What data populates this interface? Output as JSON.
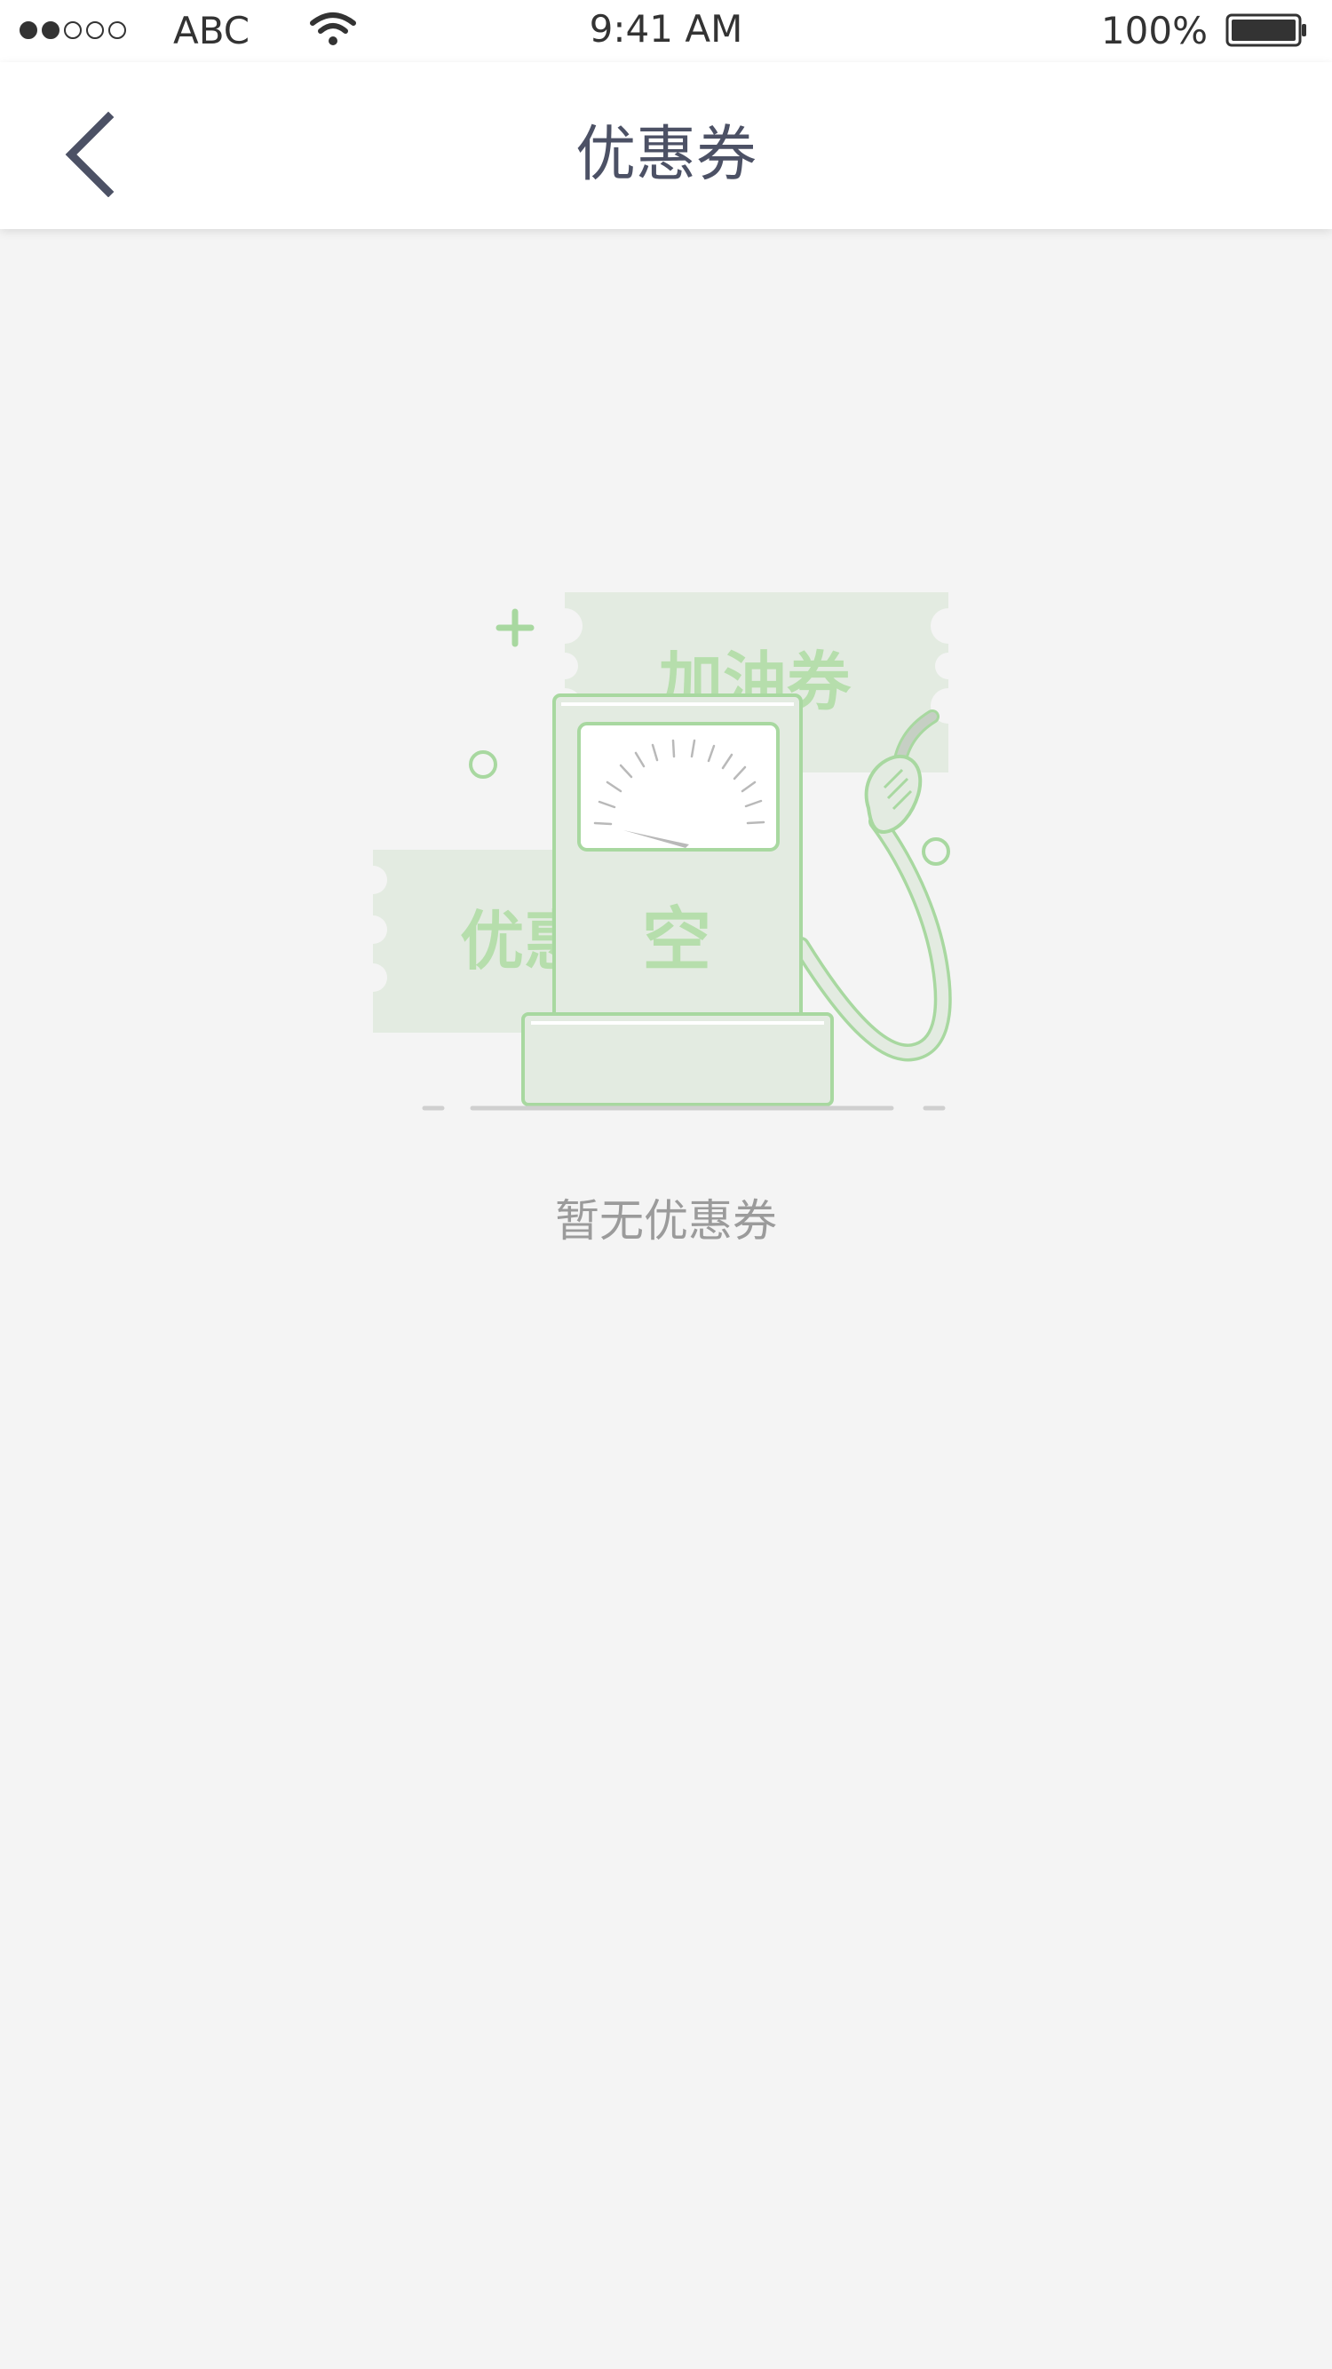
{
  "status_bar": {
    "carrier": "ABC",
    "time": "9:41 AM",
    "battery": "100%",
    "signal_bars_filled": 2,
    "signal_bars_total": 5
  },
  "nav": {
    "title": "优惠券",
    "back_icon": "chevron-left-icon"
  },
  "illustration": {
    "ticket_back_label": "加油券",
    "ticket_front_label": "优惠",
    "pump_label": "空",
    "accent_color": "#a8d8a0"
  },
  "empty_state": {
    "message": "暂无优惠券"
  }
}
